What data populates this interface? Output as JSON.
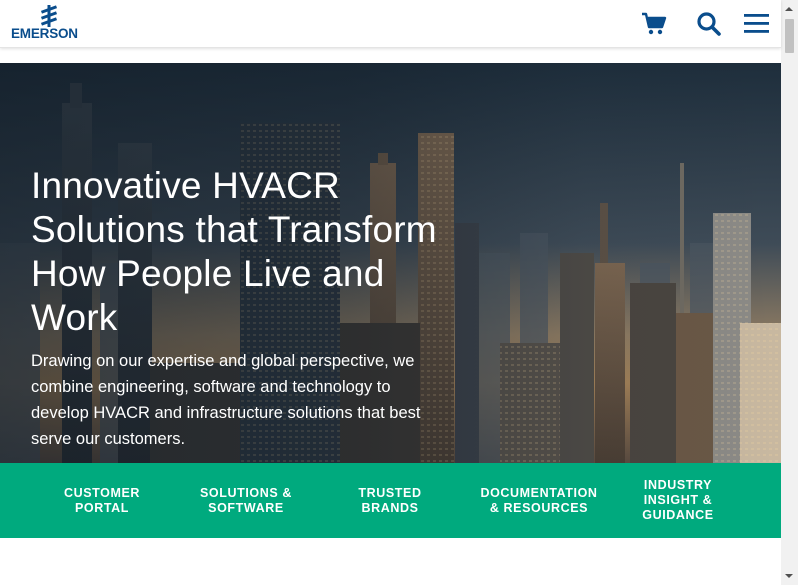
{
  "brand": {
    "name": "EMERSON"
  },
  "header": {
    "icons": [
      "cart-icon",
      "search-icon",
      "menu-icon"
    ],
    "accent_color": "#004b8d"
  },
  "hero": {
    "title": "Innovative HVACR Solutions that Transform How People Live and Work",
    "description": "Drawing on our expertise and global perspective, we combine engineering, software and technology to develop HVACR and infrastructure solutions that best serve our customers."
  },
  "quick_nav": {
    "background_color": "#00aa7e",
    "items": [
      {
        "label": "CUSTOMER\nPORTAL"
      },
      {
        "label": "SOLUTIONS &\nSOFTWARE"
      },
      {
        "label": "TRUSTED\nBRANDS"
      },
      {
        "label": "DOCUMENTATION\n& RESOURCES"
      },
      {
        "label": "INDUSTRY\nINSIGHT &\nGUIDANCE"
      }
    ]
  }
}
